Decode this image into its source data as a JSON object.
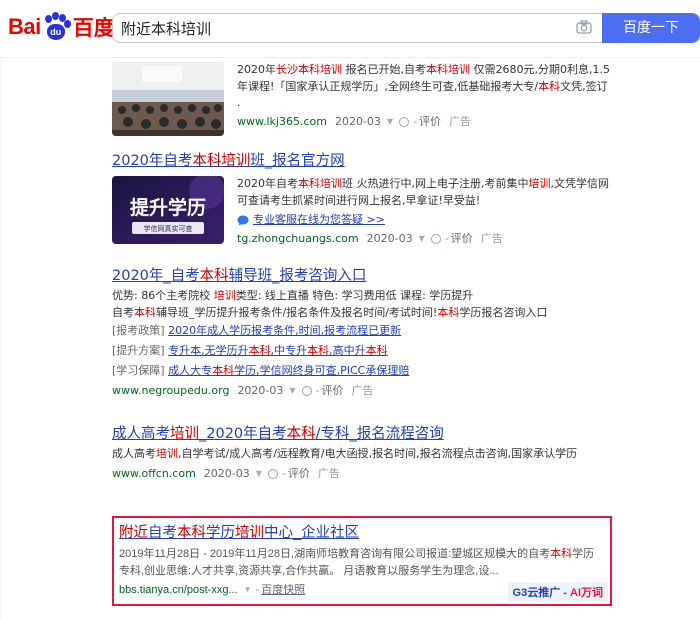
{
  "logo": {
    "text_latin": "Bai",
    "text_paw": "du",
    "text_cn": "百度"
  },
  "search": {
    "query": "附近本科培训",
    "button": "百度一下"
  },
  "results": [
    {
      "desc_parts": [
        {
          "t": "2020年"
        },
        {
          "t": "长沙本科培训",
          "em": true
        },
        {
          "t": " 报名已开始,自考"
        },
        {
          "t": "本科培训",
          "em": true
        },
        {
          "t": " 仅需2680元,分期0利息,1.5年课程!「国家承认正规学历」,全网终生可查,低基础报考大专/"
        },
        {
          "t": "本科",
          "em": true
        },
        {
          "t": "文凭,签订 ."
        }
      ],
      "url": "www.lkj365.com",
      "date": "2020-03",
      "rate": "评价",
      "ad": "广告"
    },
    {
      "title_parts": [
        {
          "t": "2020年自考"
        },
        {
          "t": "本科培训",
          "em": true
        },
        {
          "t": "班_报名官方网"
        }
      ],
      "thumb_text": "提升学历",
      "thumb_sub": "学信网真实可查",
      "desc_parts": [
        {
          "t": "2020年自考"
        },
        {
          "t": "本科培训",
          "em": true
        },
        {
          "t": "班 火热进行中,网上电子注册,考前集中"
        },
        {
          "t": "培训",
          "em": true
        },
        {
          "t": ",文凭学信网可查请考生抓紧时间进行网上报名,早拿证!早受益!"
        }
      ],
      "service_link": "专业客服在线为您答疑 >>",
      "url": "tg.zhongchuangs.com",
      "date": "2020-03",
      "rate": "评价",
      "ad": "广告"
    },
    {
      "title_parts": [
        {
          "t": "2020年_自考"
        },
        {
          "t": "本科",
          "em": true
        },
        {
          "t": "辅导班_报考咨询入口"
        }
      ],
      "line1_parts": [
        {
          "t": "优势: 86个主考院校    "
        },
        {
          "t": "培训",
          "em": true
        },
        {
          "t": "类型: 线上直播    特色: 学习费用低    课程: 学历提升"
        }
      ],
      "line2_parts": [
        {
          "t": "自考"
        },
        {
          "t": "本科",
          "em": true
        },
        {
          "t": "辅导班_学历提升报考条件/报名条件及报名时间/考试时间!"
        },
        {
          "t": "本科",
          "em": true
        },
        {
          "t": "学历报名咨询入口"
        }
      ],
      "sublinks": [
        {
          "label": "[报考政策]",
          "parts": [
            {
              "t": "2020年成人学历报考条件,时间,报考流程已更新"
            }
          ]
        },
        {
          "label": "[提升方案]",
          "parts": [
            {
              "t": "专升本,无学历升"
            },
            {
              "t": "本科",
              "em": true
            },
            {
              "t": ",中专升"
            },
            {
              "t": "本科",
              "em": true
            },
            {
              "t": ",高中升"
            },
            {
              "t": "本科",
              "em": true
            }
          ]
        },
        {
          "label": "[学习保障]",
          "parts": [
            {
              "t": "成人大专"
            },
            {
              "t": "本科",
              "em": true
            },
            {
              "t": "学历,学信网终身可查,PICC承保理赔"
            }
          ]
        }
      ],
      "url": "www.negroupedu.org",
      "date": "2020-03",
      "rate": "评价",
      "ad": "广告"
    },
    {
      "title_parts": [
        {
          "t": "成人高考"
        },
        {
          "t": "培训",
          "em": true
        },
        {
          "t": "_2020年自考"
        },
        {
          "t": "本科",
          "em": true
        },
        {
          "t": "/专科_报名流程咨询"
        }
      ],
      "desc_parts": [
        {
          "t": "成人高考"
        },
        {
          "t": "培训",
          "em": true
        },
        {
          "t": ",自学考试/成人高考/远程教育/电大函授,报名时间,报名流程点击咨询,国家承认学历"
        }
      ],
      "url": "www.offcn.com",
      "date": "2020-03",
      "rate": "评价",
      "ad": "广告"
    },
    {
      "title_parts": [
        {
          "t": "附近",
          "em": true
        },
        {
          "t": "自考"
        },
        {
          "t": "本科",
          "em": true
        },
        {
          "t": "学历"
        },
        {
          "t": "培训",
          "em": true
        },
        {
          "t": "中心_企业社区"
        }
      ],
      "desc_parts": [
        {
          "t": "2019年11月28日 - 2019年11月28日,湖南师培教育咨询有限公司报道:望城区规模大的自考"
        },
        {
          "t": "本科",
          "em": true
        },
        {
          "t": "学历专科,创业思维:人才共享,资源共享,合作共赢。 月语教育以服务学生为理念,设..."
        }
      ],
      "url": "bbs.tianya.cn/post-xxg...",
      "snapshot": "百度快照",
      "badge_blue": "G3云推广",
      "badge_red": " - AI万词"
    }
  ],
  "colors": {
    "brand_red": "#e10601",
    "brand_blue": "#2932e1",
    "button": "#4e6ef2",
    "link": "#2440b3",
    "em": "#cc0000",
    "url": "#006621",
    "highlight": "#e5163e"
  },
  "icons": [
    "camera-icon",
    "verified-icon",
    "chat-bubble-icon",
    "dropdown-arrow-icon"
  ]
}
